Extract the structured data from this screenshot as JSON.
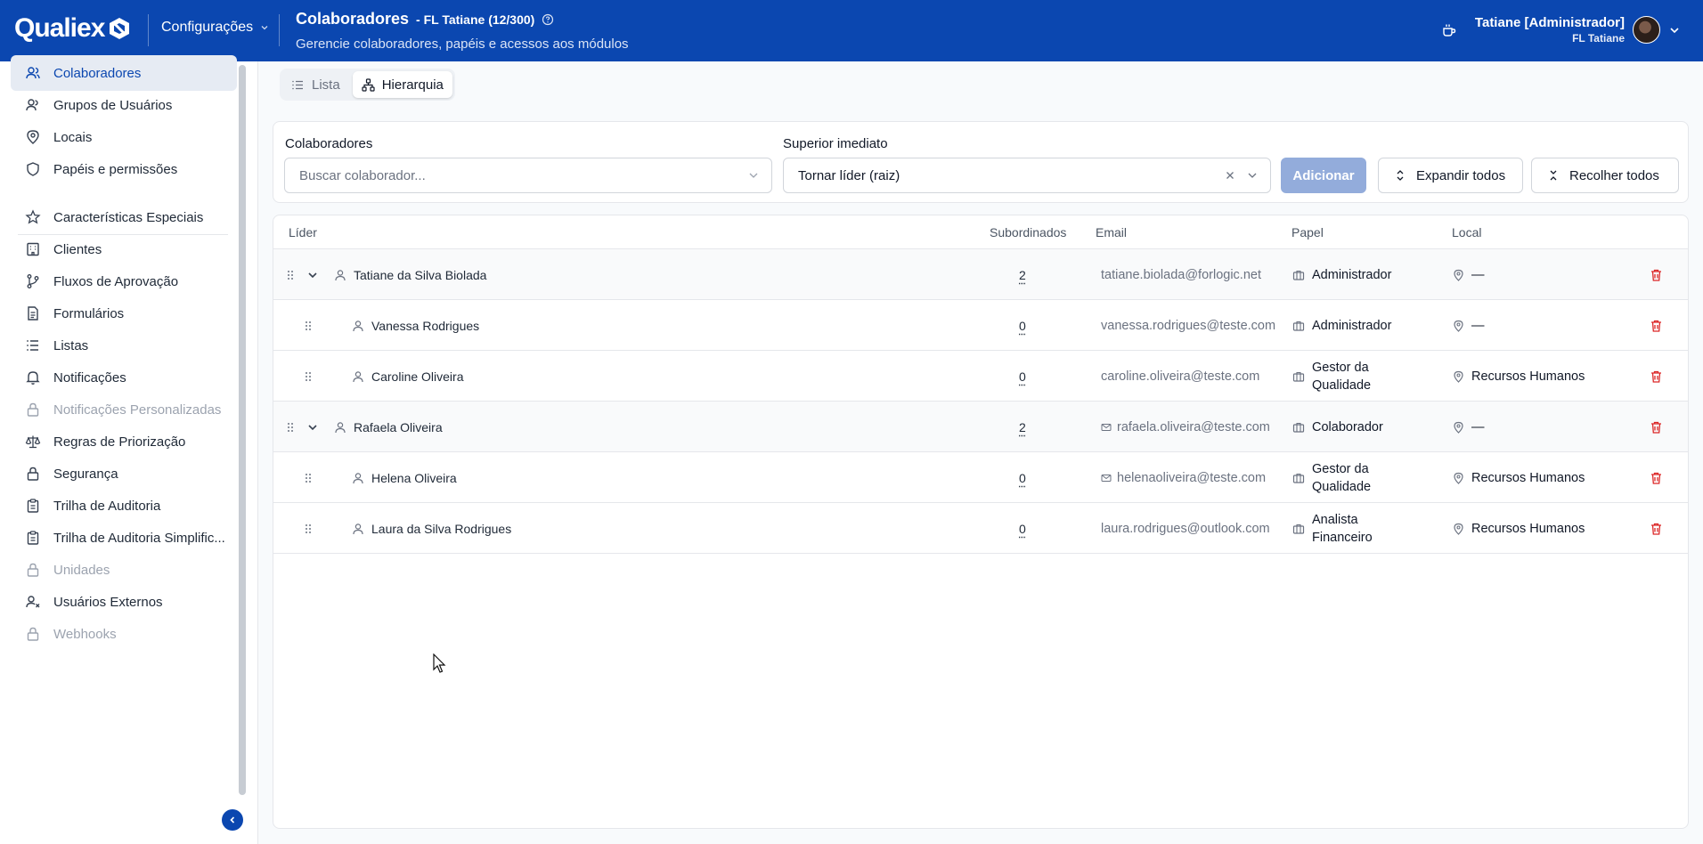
{
  "header": {
    "logo_text": "Qualiex",
    "module_label": "Configurações",
    "page_title": "Colaboradores",
    "page_context": "- FL Tatiane (12/300)",
    "page_subtitle": "Gerencie colaboradores, papéis e acessos aos módulos",
    "user_name": "Tatiane [Administrador]",
    "user_company": "FL Tatiane",
    "brand_color": "#0b47b0"
  },
  "sidebar": {
    "items": [
      {
        "label": "Colaboradores",
        "icon": "users-icon",
        "active": true,
        "disabled": false
      },
      {
        "label": "Grupos de Usuários",
        "icon": "user-group-icon",
        "active": false,
        "disabled": false
      },
      {
        "label": "Locais",
        "icon": "map-pin-icon",
        "active": false,
        "disabled": false
      },
      {
        "label": "Papéis e permissões",
        "icon": "shield-icon",
        "active": false,
        "disabled": false
      },
      {
        "label": "Características Especiais",
        "icon": "star-icon",
        "active": false,
        "disabled": false
      },
      {
        "label": "Clientes",
        "icon": "building-icon",
        "active": false,
        "disabled": false
      },
      {
        "label": "Fluxos de Aprovação",
        "icon": "git-branch-icon",
        "active": false,
        "disabled": false
      },
      {
        "label": "Formulários",
        "icon": "file-text-icon",
        "active": false,
        "disabled": false
      },
      {
        "label": "Listas",
        "icon": "list-icon",
        "active": false,
        "disabled": false
      },
      {
        "label": "Notificações",
        "icon": "bell-icon",
        "active": false,
        "disabled": false
      },
      {
        "label": "Notificações Personalizadas",
        "icon": "lock-icon",
        "active": false,
        "disabled": true
      },
      {
        "label": "Regras de Priorização",
        "icon": "scale-icon",
        "active": false,
        "disabled": false
      },
      {
        "label": "Segurança",
        "icon": "lock-icon",
        "active": false,
        "disabled": false
      },
      {
        "label": "Trilha de Auditoria",
        "icon": "clipboard-icon",
        "active": false,
        "disabled": false
      },
      {
        "label": "Trilha de Auditoria Simplific...",
        "icon": "clipboard-icon",
        "active": false,
        "disabled": false
      },
      {
        "label": "Unidades",
        "icon": "lock-icon",
        "active": false,
        "disabled": true
      },
      {
        "label": "Usuários Externos",
        "icon": "user-x-icon",
        "active": false,
        "disabled": false
      },
      {
        "label": "Webhooks",
        "icon": "lock-icon",
        "active": false,
        "disabled": true
      }
    ]
  },
  "tabs": [
    {
      "label": "Lista",
      "active": false
    },
    {
      "label": "Hierarquia",
      "active": true
    }
  ],
  "filters": {
    "colaboradores_label": "Colaboradores",
    "colaboradores_placeholder": "Buscar colaborador...",
    "superior_label": "Superior imediato",
    "superior_value": "Tornar líder (raiz)",
    "add_label": "Adicionar",
    "expand_label": "Expandir todos",
    "collapse_label": "Recolher todos"
  },
  "table": {
    "columns": [
      "Líder",
      "Subordinados",
      "Email",
      "Papel",
      "Local"
    ],
    "rows": [
      {
        "name": "Tatiane da Silva Biolada",
        "subordinates": "2",
        "email": "tatiane.biolada@forlogic.net",
        "role": "Administrador",
        "location": "—",
        "level": 0,
        "expandable": true
      },
      {
        "name": "Vanessa Rodrigues",
        "subordinates": "0",
        "email": "vanessa.rodrigues@teste.com",
        "role": "Administrador",
        "location": "—",
        "level": 1,
        "expandable": false
      },
      {
        "name": "Caroline Oliveira",
        "subordinates": "0",
        "email": "caroline.oliveira@teste.com",
        "role": "Gestor da Qualidade",
        "location": "Recursos Humanos",
        "level": 1,
        "expandable": false
      },
      {
        "name": "Rafaela Oliveira",
        "subordinates": "2",
        "email": "rafaela.oliveira@teste.com",
        "role": "Colaborador",
        "location": "—",
        "level": 0,
        "expandable": true
      },
      {
        "name": "Helena Oliveira",
        "subordinates": "0",
        "email": "helenaoliveira@teste.com",
        "role": "Gestor da Qualidade",
        "location": "Recursos Humanos",
        "level": 1,
        "expandable": false
      },
      {
        "name": "Laura da Silva Rodrigues",
        "subordinates": "0",
        "email": "laura.rodrigues@outlook.com",
        "role": "Analista Financeiro",
        "location": "Recursos Humanos",
        "level": 1,
        "expandable": false
      }
    ]
  }
}
